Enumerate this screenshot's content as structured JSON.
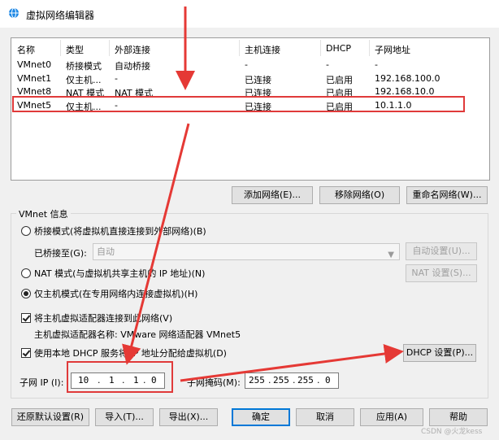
{
  "window": {
    "title": "虚拟网络编辑器"
  },
  "table": {
    "headers": [
      "名称",
      "类型",
      "外部连接",
      "主机连接",
      "DHCP",
      "子网地址"
    ],
    "rows": [
      [
        "VMnet0",
        "桥接模式",
        "自动桥接",
        "-",
        "-",
        "-"
      ],
      [
        "VMnet1",
        "仅主机...",
        "-",
        "已连接",
        "已启用",
        "192.168.100.0"
      ],
      [
        "VMnet8",
        "NAT 模式",
        "NAT 模式",
        "已连接",
        "已启用",
        "192.168.10.0"
      ],
      [
        "VMnet5",
        "仅主机...",
        "-",
        "已连接",
        "已启用",
        "10.1.1.0"
      ]
    ],
    "selected_index": 3
  },
  "list_buttons": {
    "add": "添加网络(E)...",
    "remove": "移除网络(O)",
    "rename": "重命名网络(W)..."
  },
  "vmnet_info": {
    "title": "VMnet 信息",
    "bridged_label": "桥接模式(将虚拟机直接连接到外部网络)(B)",
    "bridged_to_label": "已桥接至(G):",
    "bridged_to_value": "自动",
    "auto_settings": "自动设置(U)...",
    "nat_label": "NAT 模式(与虚拟机共享主机的 IP 地址)(N)",
    "nat_settings": "NAT 设置(S)...",
    "hostonly_label": "仅主机模式(在专用网络内连接虚拟机)(H)",
    "connect_adapter_label": "将主机虚拟适配器连接到此网络(V)",
    "adapter_name_label": "主机虚拟适配器名称: VMware 网络适配器 VMnet5",
    "dhcp_label": "使用本地 DHCP 服务将 IP 地址分配给虚拟机(D)",
    "dhcp_settings": "DHCP 设置(P)...",
    "subnet_ip_label": "子网 IP (I):",
    "subnet_ip": [
      "10",
      "1",
      "1",
      "0"
    ],
    "subnet_mask_label": "子网掩码(M):",
    "subnet_mask": [
      "255",
      "255",
      "255",
      "0"
    ]
  },
  "bottom_buttons": {
    "restore": "还原默认设置(R)",
    "import": "导入(T)...",
    "export": "导出(X)...",
    "ok": "确定",
    "cancel": "取消",
    "apply": "应用(A)",
    "help": "帮助"
  },
  "watermark": "CSDN @火龙kess"
}
